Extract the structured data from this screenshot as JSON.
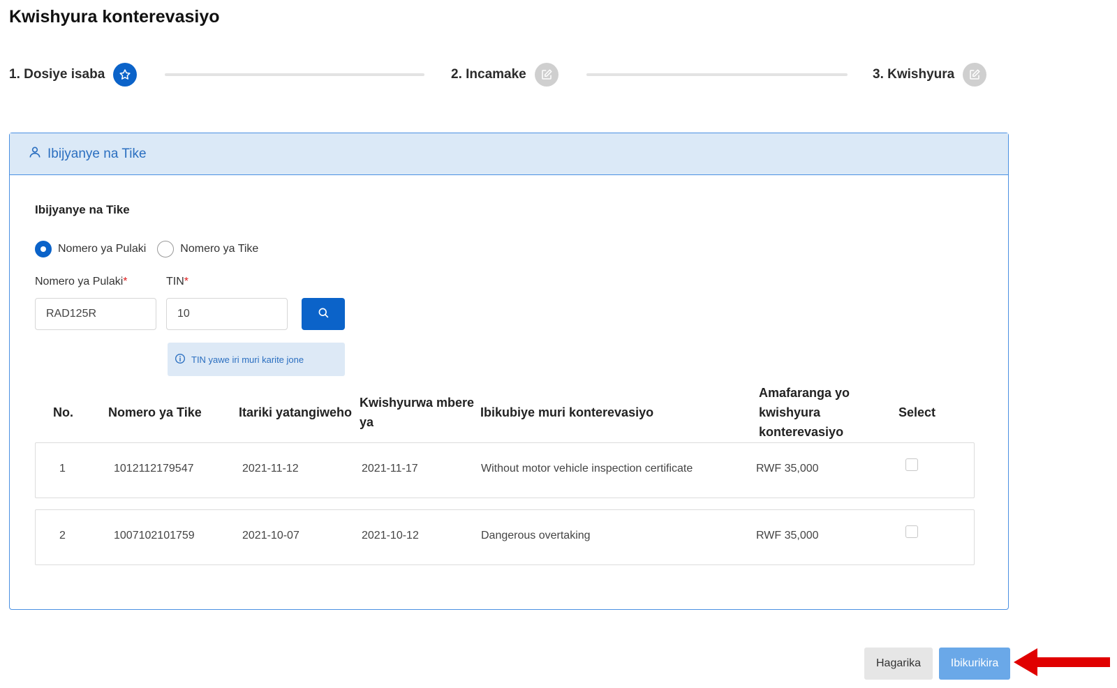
{
  "page": {
    "title": "Kwishyura konterevasiyo"
  },
  "stepper": {
    "steps": [
      {
        "label": "1. Dosiye isaba",
        "state": "active",
        "icon": "star-icon"
      },
      {
        "label": "2. Incamake",
        "state": "inactive",
        "icon": "edit-icon"
      },
      {
        "label": "3. Kwishyura",
        "state": "inactive",
        "icon": "edit-icon"
      }
    ]
  },
  "card": {
    "header": "Ibijyanye na Tike",
    "header_icon": "user-icon",
    "section_title": "Ibijyanye na Tike",
    "radio": {
      "options": [
        "Nomero ya Pulaki",
        "Nomero ya Tike"
      ],
      "selected": "Nomero ya Pulaki"
    },
    "plate_label": "Nomero ya Pulaki",
    "plate_value": "RAD125R",
    "tin_label": "TIN",
    "tin_value": "10",
    "required_mark": "*",
    "search_icon": "search-icon",
    "hint": "TIN yawe iri muri karite jone",
    "hint_icon": "info-icon"
  },
  "table": {
    "headers": [
      "No.",
      "Nomero ya Tike",
      "Itariki yatangiweho",
      "Kwishyurwa mbere ya",
      "Ibikubiye muri konterevasiyo",
      "Amafaranga yo kwishyura konterevasiyo",
      "Select"
    ],
    "rows": [
      {
        "no": "1",
        "ticket": "1012112179547",
        "issued": "2021-11-12",
        "due": "2021-11-17",
        "offense": "Without motor vehicle inspection certificate",
        "amount": "RWF 35,000",
        "selected": false
      },
      {
        "no": "2",
        "ticket": "1007102101759",
        "issued": "2021-10-07",
        "due": "2021-10-12",
        "offense": "Dangerous overtaking",
        "amount": "RWF 35,000",
        "selected": false
      }
    ]
  },
  "footer": {
    "cancel": "Hagarika",
    "next": "Ibikurikira"
  },
  "colors": {
    "primary": "#0b63c9",
    "header_bg": "#dbe9f7",
    "next_button": "#6aa8e8",
    "annotation_arrow": "#e00000"
  }
}
